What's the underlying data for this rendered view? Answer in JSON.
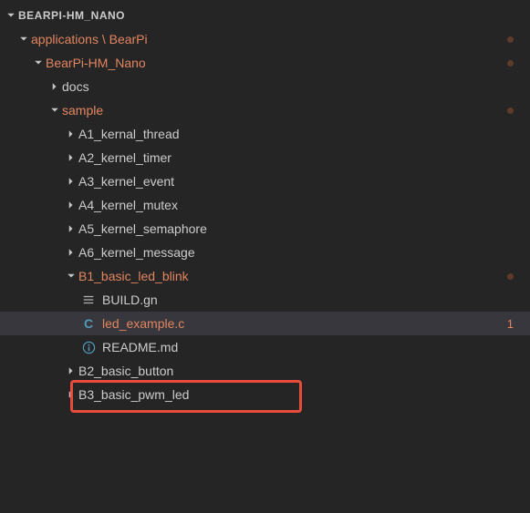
{
  "header": {
    "title": "BEARPI-HM_NANO"
  },
  "tree": {
    "applications": {
      "label": "applications \\ BearPi",
      "bearpi_nano": {
        "label": "BearPi-HM_Nano",
        "docs": {
          "label": "docs"
        },
        "sample": {
          "label": "sample",
          "items": [
            {
              "label": "A1_kernal_thread"
            },
            {
              "label": "A2_kernel_timer"
            },
            {
              "label": "A3_kernel_event"
            },
            {
              "label": "A4_kernel_mutex"
            },
            {
              "label": "A5_kernel_semaphore"
            },
            {
              "label": "A6_kernel_message"
            }
          ],
          "b1": {
            "label": "B1_basic_led_blink",
            "files": [
              {
                "label": "BUILD.gn"
              },
              {
                "label": "led_example.c",
                "badge": "1"
              },
              {
                "label": "README.md"
              }
            ]
          },
          "b2": {
            "label": "B2_basic_button"
          },
          "b3": {
            "label": "B3_basic_pwm_led"
          }
        }
      }
    }
  }
}
